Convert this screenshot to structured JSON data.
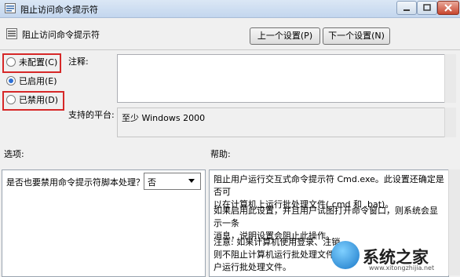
{
  "window": {
    "title": "阻止访问命令提示符"
  },
  "header": {
    "setting_title": "阻止访问命令提示符",
    "prev_label": "上一个设置(P)",
    "next_label": "下一个设置(N)"
  },
  "state": {
    "options": [
      {
        "label": "未配置(C)",
        "selected": false
      },
      {
        "label": "已启用(E)",
        "selected": true
      },
      {
        "label": "已禁用(D)",
        "selected": false
      }
    ]
  },
  "comment": {
    "label": "注释:",
    "value": ""
  },
  "platform": {
    "label": "支持的平台:",
    "value": "至少 Windows 2000"
  },
  "options_pane": {
    "label": "选项:",
    "question": "是否也要禁用命令提示符脚本处理？",
    "select_value": "否"
  },
  "help_pane": {
    "label": "帮助:",
    "paragraphs": [
      "阻止用户运行交互式命令提示符 Cmd.exe。此设置还确定是否可\n以在计算机上运行批处理文件(.cmd 和 .bat)。",
      "如果启用此设置，并且用户试图打开命令窗口，则系统会显示一条\n消息，说明设置会阻止此操作。",
      "注意: 如果计算机使用登录、注销\n则不阻止计算机运行批处理文件，\n户运行批处理文件。"
    ]
  },
  "watermark": {
    "text": "系统之家",
    "url": "www.xitongzhijia.net"
  },
  "colors": {
    "highlight": "#d62828",
    "accent": "#2b6fd6"
  }
}
